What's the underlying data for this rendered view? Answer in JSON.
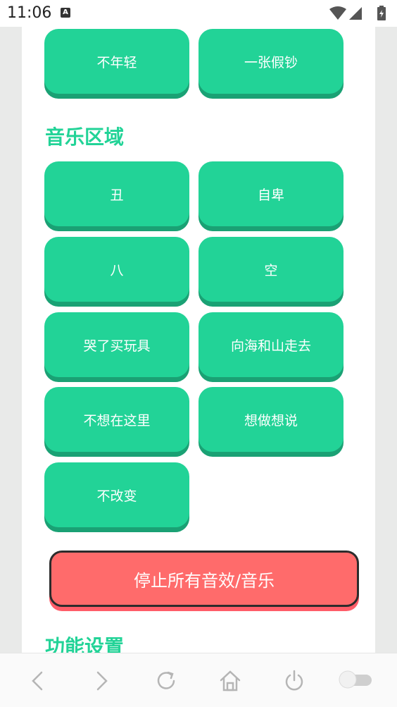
{
  "status_bar": {
    "time": "11:06",
    "notification_badge": "A"
  },
  "buttons_top": [
    "不年轻",
    "一张假钞"
  ],
  "music_section": {
    "title": "音乐区域",
    "buttons": [
      "丑",
      "自卑",
      "八",
      "空",
      "哭了买玩具",
      "向海和山走去",
      "不想在这里",
      "想做想说",
      "不改变"
    ]
  },
  "stop_button": {
    "label": "停止所有音效/音乐"
  },
  "settings_section": {
    "title": "功能设置"
  },
  "nav": {
    "icons": [
      "back-icon",
      "forward-icon",
      "refresh-icon",
      "home-icon",
      "power-icon",
      "toggle-switch"
    ]
  },
  "colors": {
    "accent_green": "#22d397",
    "stop_red": "#ff6b6b"
  }
}
